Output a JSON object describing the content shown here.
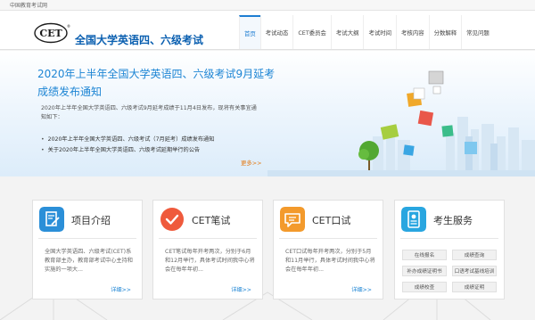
{
  "topbar": {
    "text": "中国教育考试网"
  },
  "header": {
    "logo_text": "CET",
    "logo_mark": "®",
    "site_title": "全国大学英语四、六级考试"
  },
  "nav": [
    {
      "label": "首页",
      "active": true
    },
    {
      "label": "考试动态"
    },
    {
      "label": "CET委员会"
    },
    {
      "label": "考试大纲"
    },
    {
      "label": "考试时间"
    },
    {
      "label": "考核内容"
    },
    {
      "label": "分数解释"
    },
    {
      "label": "常见问题"
    }
  ],
  "banner": {
    "title_line1": "2020年上半年全国大学英语四、六级考试9月延考",
    "title_line2": "成绩发布通知",
    "intro": "2020年上半年全国大学英语四、六级考试9月延考成绩于11月4日发布，现将有关事宜通知如下：",
    "links": [
      "2020年上半年全国大学英语四、六级考试（7月延考）成绩发布通知",
      "关于2020年上半年全国大学英语四、六级考试延期举行的公告"
    ],
    "more": "更多>>"
  },
  "cards": {
    "intro": {
      "title": "项目介绍",
      "desc": "全国大学英语四、六级考试(CET)系教育部主办，教育部考试中心主持和实施的一项大...",
      "more": "详细>>",
      "color": "#2b8fd8"
    },
    "written": {
      "title": "CET笔试",
      "desc": "CET笔试每年开考两次，分别于6月和12月举行，具体考试时间我中心将会在每年年初...",
      "more": "详细>>",
      "color": "#ef5a3c"
    },
    "oral": {
      "title": "CET口试",
      "desc": "CET口试每年开考两次，分别于5月和11月举行，具体考试时间我中心将会在每年年初...",
      "more": "详细>>",
      "color": "#f39a2c"
    },
    "service": {
      "title": "考生服务",
      "color": "#29a6e0",
      "buttons": [
        "在线报名",
        "成绩查询",
        "补办成绩证明书",
        "口语考试基线培训",
        "成绩校查",
        "成绩证明"
      ]
    }
  }
}
